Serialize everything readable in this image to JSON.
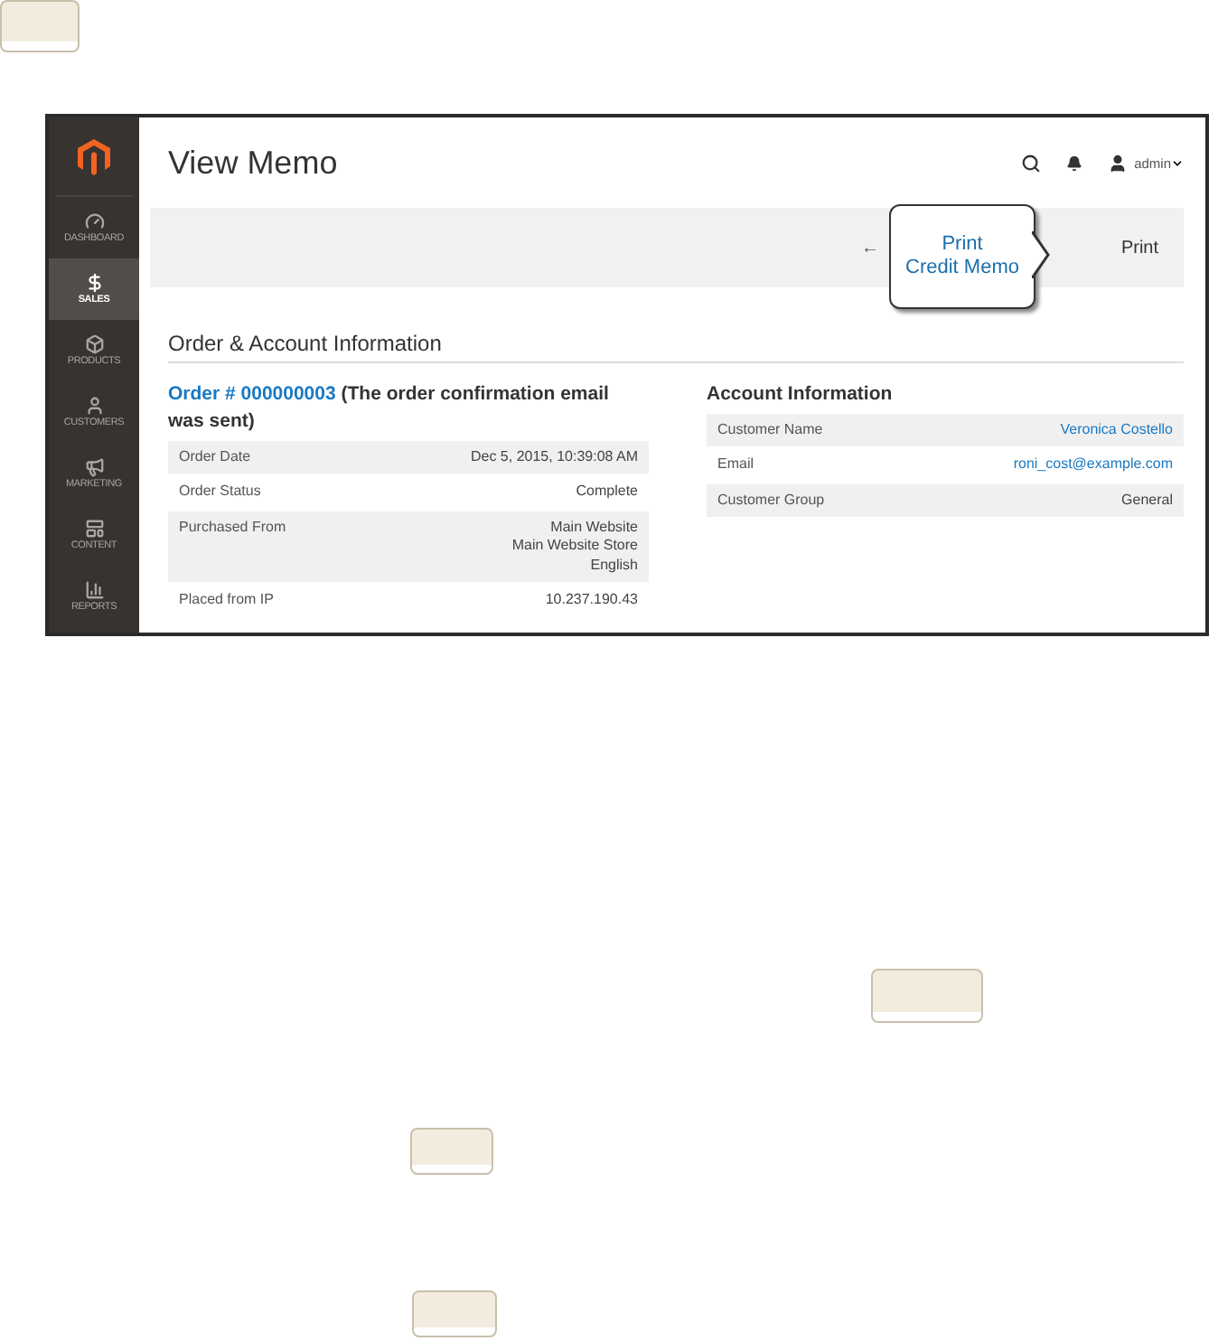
{
  "sidebar": {
    "items": [
      {
        "kind": "dashboard",
        "label": "DASHBOARD",
        "selected": false
      },
      {
        "kind": "sales",
        "label": "SALES",
        "selected": true
      },
      {
        "kind": "products",
        "label": "PRODUCTS",
        "selected": false
      },
      {
        "kind": "customers",
        "label": "CUSTOMERS",
        "selected": false
      },
      {
        "kind": "marketing",
        "label": "MARKETING",
        "selected": false
      },
      {
        "kind": "content",
        "label": "CONTENT",
        "selected": false
      },
      {
        "kind": "reports",
        "label": "REPORTS",
        "selected": false
      }
    ]
  },
  "header": {
    "title": "View Memo",
    "user": "admin"
  },
  "toolbar": {
    "back": "←",
    "callout": [
      "Print",
      "Credit Memo"
    ],
    "button": "Print"
  },
  "section_title": "Order & Account Information",
  "order": {
    "link": "Order # 000000003",
    "note": "(The order confirmation email was sent)",
    "rows": [
      {
        "label": "Order Date",
        "value": [
          "Dec 5, 2015, 10:39:08 AM"
        ]
      },
      {
        "label": "Order Status",
        "value": [
          "Complete"
        ]
      },
      {
        "label": "Purchased From",
        "value": [
          "Main Website",
          "Main Website Store",
          "English"
        ]
      },
      {
        "label": "Placed from IP",
        "value": [
          "10.237.190.43"
        ]
      }
    ]
  },
  "account": {
    "title": "Account Information",
    "rows": [
      {
        "label": "Customer Name",
        "value": "Veronica Costello",
        "link": true
      },
      {
        "label": "Email",
        "value": "roni_cost@example.com",
        "link": true
      },
      {
        "label": "Customer Group",
        "value": "General",
        "link": false
      }
    ]
  }
}
